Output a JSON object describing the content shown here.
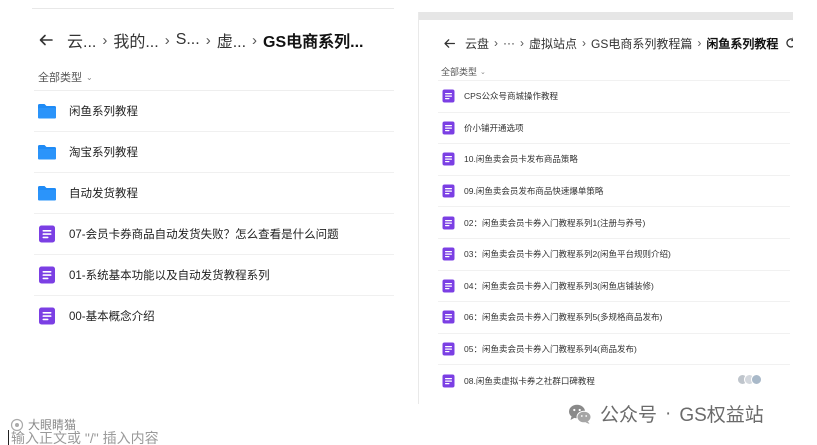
{
  "left_panel": {
    "breadcrumb": {
      "items": [
        "云...",
        "我的...",
        "S...",
        "虚..."
      ],
      "current": "GS电商系列..."
    },
    "filter_label": "全部类型",
    "files": [
      {
        "name": "闲鱼系列教程",
        "type": "folder"
      },
      {
        "name": "淘宝系列教程",
        "type": "folder"
      },
      {
        "name": "自动发货教程",
        "type": "folder"
      },
      {
        "name": "07-会员卡券商品自动发货失败？怎么查看是什么问题",
        "type": "doc"
      },
      {
        "name": "01-系统基本功能以及自动发货教程系列",
        "type": "doc"
      },
      {
        "name": "00-基本概念介绍",
        "type": "doc"
      }
    ]
  },
  "right_panel": {
    "breadcrumb": {
      "items": [
        "云盘",
        "···",
        "虚拟站点",
        "GS电商系列教程篇"
      ],
      "current": "闲鱼系列教程"
    },
    "filter_label": "全部类型",
    "files": [
      {
        "name": "CPS公众号商城操作教程"
      },
      {
        "name": "价小铺开通选项"
      },
      {
        "name": "10.闲鱼卖会员卡发布商品策略"
      },
      {
        "name": "09.闲鱼卖会员发布商品快速爆单策略"
      },
      {
        "name": "02：闲鱼卖会员卡券入门教程系列1(注册与养号)"
      },
      {
        "name": "03：闲鱼卖会员卡券入门教程系列2(闲鱼平台规则介绍)"
      },
      {
        "name": "04：闲鱼卖会员卡券入门教程系列3(闲鱼店铺装修)"
      },
      {
        "name": "06：闲鱼卖会员卡券入门教程系列5(多规格商品发布)"
      },
      {
        "name": "05：闲鱼卖会员卡券入门教程系列4(商品发布)"
      },
      {
        "name": "08.闲鱼卖虚拟卡券之社群口碑教程"
      }
    ]
  },
  "bottom": {
    "watermark_left": "大眼睛猫",
    "input_hint": "输入正文或 \"/\" 插入内容",
    "watermark_right": {
      "prefix": "公众号",
      "separator": "·",
      "name": "GS权益站"
    }
  },
  "colors": {
    "folder_blue": "#1f8bf6",
    "doc_purple": "#7b3fe4",
    "text_primary": "#1f2329",
    "divider": "#f0f0f0"
  },
  "icons": {
    "back": "arrow-left-icon",
    "folder": "folder-icon",
    "doc": "document-icon",
    "refresh": "refresh-icon",
    "wechat": "wechat-icon"
  }
}
